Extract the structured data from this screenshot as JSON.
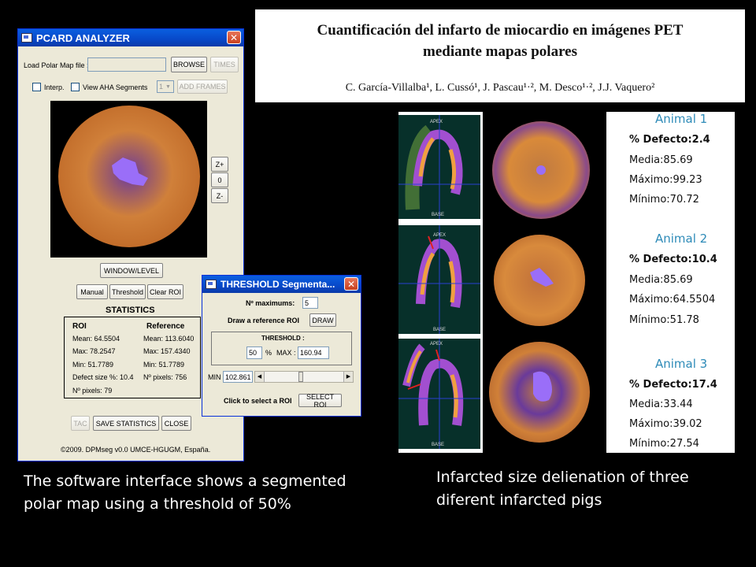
{
  "main_window": {
    "title": "PCARD ANALYZER",
    "load_label": "Load Polar Map file :",
    "browse": "BROWSE",
    "times": "TIMES",
    "interp": "Interp.",
    "view_aha": "View AHA Segments",
    "frame_select": "1",
    "add_frames": "ADD FRAMES",
    "zoom_in": "Z+",
    "zoom_reset": "0",
    "zoom_out": "Z-",
    "window_level": "WINDOW/LEVEL",
    "manual": "Manual",
    "threshold": "Threshold",
    "clear_roi": "Clear ROI",
    "statistics": "STATISTICS",
    "roi_head": "ROI",
    "ref_head": "Reference",
    "roi_mean": "Mean: 64.5504",
    "roi_max": "Max: 78.2547",
    "roi_min": "Min: 51.7789",
    "roi_defect": "Defect size %: 10.4",
    "roi_pixels": "Nº pixels: 79",
    "ref_mean": "Mean: 113.6040",
    "ref_max": "Max: 157.4340",
    "ref_min": "Min: 51.7789",
    "ref_pixels": "Nº pixels: 756",
    "tac": "TAC",
    "save_stats": "SAVE STATISTICS",
    "close": "CLOSE",
    "footer": "©2009. DPMseg v0.0 UMCE-HGUGM, España."
  },
  "threshold_window": {
    "title": "THRESHOLD Segmenta...",
    "n_max_label": "Nº maximums:",
    "n_max_value": "5",
    "draw_ref_label": "Draw a reference ROI",
    "draw": "DRAW",
    "threshold_label": "THRESHOLD :",
    "pct_value": "50",
    "pct_sign": "%",
    "max_label": "MAX :",
    "max_value": "160.94",
    "min_label": "MIN",
    "min_value": "102.861",
    "slider_fraction": 0.5,
    "click_roi_label": "Click to select a ROI",
    "select_roi": "SELECT ROI"
  },
  "paper": {
    "title_line1": "Cuantificación del infarto de miocardio en imágenes PET",
    "title_line2": "mediante mapas polares",
    "authors": "C. García-Villalba¹, L. Cussó¹, J. Pascau¹·², M. Desco¹·², J.J. Vaquero²"
  },
  "scan_labels": {
    "apex": "APEX",
    "base": "BASE"
  },
  "animals": [
    {
      "name": "Animal 1",
      "defect": "% Defecto:2.4",
      "media": "Media:85.69",
      "maximo": "Máximo:99.23",
      "minimo": "Mínimo:70.72"
    },
    {
      "name": "Animal 2",
      "defect": "% Defecto:10.4",
      "media": "Media:85.69",
      "maximo": "Máximo:64.5504",
      "minimo": "Mínimo:51.78"
    },
    {
      "name": "Animal 3",
      "defect": "% Defecto:17.4",
      "media": "Media:33.44",
      "maximo": "Máximo:39.02",
      "minimo": "Mínimo:27.54"
    }
  ],
  "captions": {
    "left_line1": "The software interface shows a segmented",
    "left_line2": "polar map using a threshold of 50%",
    "right_line1": "Infarcted size delienation of three",
    "right_line2": "diferent infarcted pigs"
  },
  "colors": {
    "titlebar": "#0a4fd0",
    "window_bg": "#ece9d8",
    "animal_heading": "#2e8bb8",
    "polar_orange": "#d98a3a",
    "defect_purple": "#8a5cf0"
  }
}
